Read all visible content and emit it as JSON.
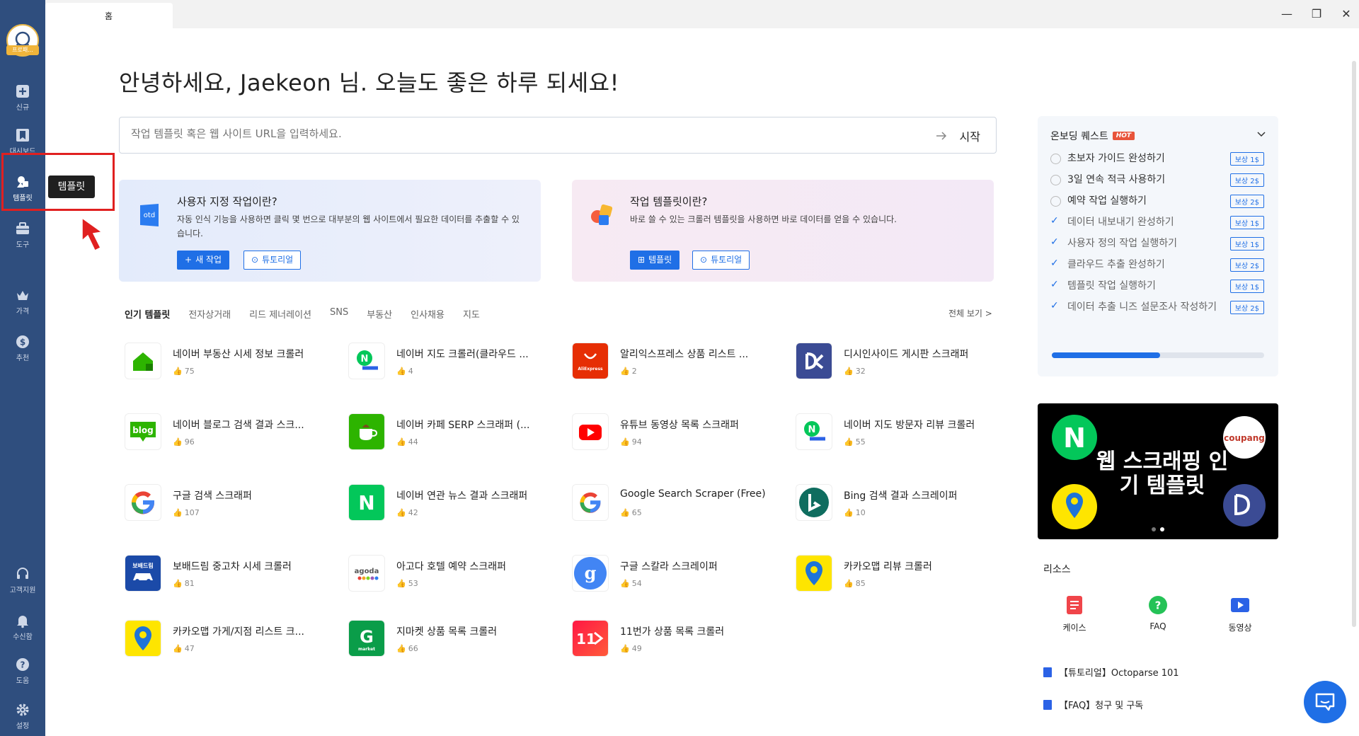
{
  "window": {
    "tab_label": "홈",
    "minimize": "—",
    "restore": "❐",
    "close": "✕"
  },
  "sidebar": {
    "avatar_badge": "프로패...",
    "items": [
      {
        "label": "신규",
        "icon": "plus-square-icon"
      },
      {
        "label": "대시보드",
        "icon": "bookmark-icon"
      },
      {
        "label": "템플릿",
        "icon": "template-icon"
      },
      {
        "label": "도구",
        "icon": "toolbox-icon"
      },
      {
        "label": "가격",
        "icon": "crown-icon"
      },
      {
        "label": "추천",
        "icon": "dollar-icon"
      },
      {
        "label": "고객지원",
        "icon": "headset-icon"
      },
      {
        "label": "수신함",
        "icon": "bell-icon"
      },
      {
        "label": "도움",
        "icon": "help-icon"
      },
      {
        "label": "설정",
        "icon": "gear-icon"
      }
    ],
    "tooltip": "템플릿"
  },
  "greeting": "안녕하세요, Jaekeon 님. 오늘도 좋은 하루 되세요!",
  "search": {
    "placeholder": "작업 템플릿 혹은 웹 사이트 URL을 입력하세요.",
    "start_label": "시작"
  },
  "cards": [
    {
      "title": "사용자 지정 작업이란?",
      "desc": "자동 인식 기능을 사용하면 클릭 몇 번으로 대부분의 웹 사이트에서 필요한 데이터를 추출할 수 있습니다.",
      "primary": "새 작업",
      "secondary": "튜토리얼"
    },
    {
      "title": "작업 템플릿이란?",
      "desc": "바로 쓸 수 있는 크롤러 템플릿을 사용하면 바로 데이터를 얻을 수 있습니다.",
      "primary": "템플릿",
      "secondary": "튜토리얼"
    }
  ],
  "categories": [
    "인기 템플릿",
    "전자상거래",
    "리드 제너레이션",
    "SNS",
    "부동산",
    "인사채용",
    "지도"
  ],
  "see_all": "전체 보기 >",
  "templates": [
    {
      "name": "네이버 부동산 시세 정보 크롤러",
      "likes": "75"
    },
    {
      "name": "네이버 지도 크롤러(클라우드 ...",
      "likes": "4"
    },
    {
      "name": "알리익스프레스 상품 리스트 ...",
      "likes": "2"
    },
    {
      "name": "디시인사이드 게시판 스크래퍼",
      "likes": "32"
    },
    {
      "name": "네이버 블로그 검색 결과 스크...",
      "likes": "96"
    },
    {
      "name": "네이버 카페 SERP 스크래퍼 (...",
      "likes": "44"
    },
    {
      "name": "유튜브 동영상 목록 스크래퍼",
      "likes": "94"
    },
    {
      "name": "네이버 지도 방문자 리뷰 크롤러",
      "likes": "55"
    },
    {
      "name": "구글 검색 스크래퍼",
      "likes": "107"
    },
    {
      "name": "네이버 연관 뉴스 결과 스크래퍼",
      "likes": "42"
    },
    {
      "name": "Google Search Scraper (Free)",
      "likes": "65"
    },
    {
      "name": "Bing 검색 결과 스크레이퍼",
      "likes": "10"
    },
    {
      "name": "보배드림 중고차 시세 크롤러",
      "likes": "81"
    },
    {
      "name": "아고다 호텔 예약 스크래퍼",
      "likes": "53"
    },
    {
      "name": "구글 스칼라 스크레이퍼",
      "likes": "54"
    },
    {
      "name": "카카오맵 리뷰 크롤러",
      "likes": "85"
    },
    {
      "name": "카카오맵 가게/지점 리스트 크...",
      "likes": "47"
    },
    {
      "name": "지마켓 상품 목록 크롤러",
      "likes": "66"
    },
    {
      "name": "11번가 상품 목록 크롤러",
      "likes": "49"
    }
  ],
  "logo_text": {
    "otd": "otd",
    "blog": "blog",
    "n": "N",
    "g": "G",
    "market": "market",
    "bobae": "보배드림",
    "agoda": "agoda",
    "eleven": "11",
    "aliexpress": "AliExpress"
  },
  "quest": {
    "title": "온보딩 퀘스트",
    "hot": "HOT",
    "progress": 0.51,
    "items": [
      {
        "text": "초보자 가이드 완성하기",
        "reward": "보상 1$",
        "done": false
      },
      {
        "text": "3일 연속 적극 사용하기",
        "reward": "보상 2$",
        "done": false
      },
      {
        "text": "예약 작업 실행하기",
        "reward": "보상 2$",
        "done": false
      },
      {
        "text": "데이터 내보내기 완성하기",
        "reward": "보상 1$",
        "done": true
      },
      {
        "text": "사용자 정의 작업 실행하기",
        "reward": "보상 1$",
        "done": true
      },
      {
        "text": "클라우드 추출 완성하기",
        "reward": "보상 2$",
        "done": true
      },
      {
        "text": "템플릿 작업 실행하기",
        "reward": "보상 1$",
        "done": true
      },
      {
        "text": "데이터 추출 니즈 설문조사 작성하기",
        "reward": "보상 2$",
        "done": true
      }
    ]
  },
  "banner": {
    "title": "웹 스크래핑 인기 템플릿",
    "coupang": "coupang"
  },
  "resources": {
    "title": "리소스",
    "items": [
      "케이스",
      "FAQ",
      "동영상"
    ],
    "links": [
      "【튜토리얼】Octoparse 101",
      "【FAQ】청구 및 구독"
    ]
  },
  "colors": {
    "sidebar": "#2f4e7e",
    "accent": "#1f6fe6",
    "highlight": "#e02020",
    "hot": "#e8543a"
  }
}
